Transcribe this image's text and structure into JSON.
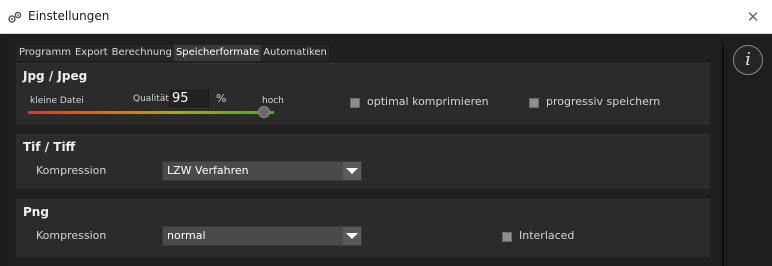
{
  "window": {
    "title": "Einstellungen",
    "close_glyph": "✕",
    "app_icon": "settings-gears-icon"
  },
  "tabs": [
    {
      "label": "Programm",
      "active": false
    },
    {
      "label": "Export",
      "active": false
    },
    {
      "label": "Berechnung",
      "active": false
    },
    {
      "label": "Speicherformate",
      "active": true
    },
    {
      "label": "Automatiken",
      "active": false
    }
  ],
  "info_button": {
    "glyph": "i",
    "icon": "info-icon"
  },
  "jpg": {
    "title": "Jpg / Jpeg",
    "small_label": "kleine Datei",
    "quality_label": "Qualität",
    "quality_value": "95",
    "quality_unit": "%",
    "high_label": "hoch",
    "quality_fraction": 0.95,
    "optimize_label": "optimal komprimieren",
    "optimize_checked": false,
    "progressive_label": "progressiv speichern",
    "progressive_checked": false
  },
  "tif": {
    "title": "Tif / Tiff",
    "compression_label": "Kompression",
    "compression_value": "LZW Verfahren"
  },
  "png": {
    "title": "Png",
    "compression_label": "Kompression",
    "compression_value": "normal",
    "interlaced_label": "Interlaced",
    "interlaced_checked": false
  },
  "colors": {
    "background": "#1c1c1c",
    "panel": "#2b2b2b",
    "select": "#4a4a4a",
    "slider_start": "#d13a30",
    "slider_end": "#4aa83a"
  }
}
